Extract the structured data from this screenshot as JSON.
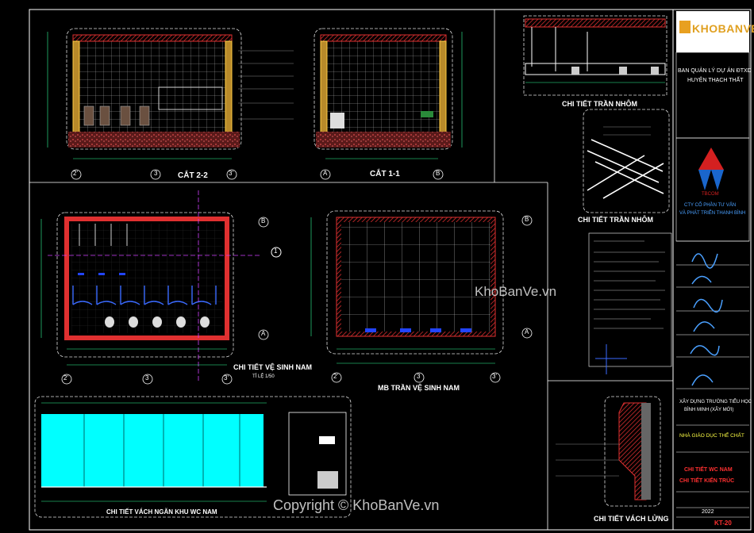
{
  "sheet": {
    "logo_text": "KHOBANVE",
    "owner_line1": "BAN QUẢN LÝ DỰ ÁN ĐTXD",
    "owner_line2": "HUYỆN THẠCH THẤT",
    "company_line1": "CTY CỔ PHẦN TƯ VẤN",
    "company_line2": "VÀ PHÁT TRIỂN THANH BÌNH",
    "company_abbr": "TBCOM",
    "project_line1": "XÂY DỰNG TRƯỜNG TIỂU HỌC",
    "project_line2": "BÌNH MINH (XÂY MỚI)",
    "building": "NHÀ GIÁO DỤC THỂ CHẤT",
    "drawing_title1": "CHI TIẾT WC NAM",
    "drawing_title2": "CHI TIẾT KIẾN TRÚC",
    "year": "2022",
    "sheet_no": "KT-20"
  },
  "views": {
    "section_22": "CẮT 2-2",
    "section_11": "CẮT 1-1",
    "ceiling_detail_a": "CHI TIẾT TRẦN NHÔM",
    "ceiling_detail_b": "CHI TIẾT TRẦN NHÔM",
    "wc_plan": "CHI TIẾT VỆ SINH NAM",
    "wc_plan_scale": "TỈ LỆ 1/50",
    "ceiling_plan": "MB TRẦN VỆ SINH NAM",
    "partition": "CHI TIẾT VÁCH NGĂN KHU WC NAM",
    "half_wall": "CHI TIẾT VÁCH LỬNG"
  },
  "axes": {
    "a": "A",
    "b": "B",
    "n1": "1",
    "n2": "2",
    "n3": "3",
    "n2p": "2'",
    "n3p": "3'"
  },
  "watermark": {
    "center": "KhoBanVe.vn",
    "bottom": "Copyright © KhoBanVe.vn"
  },
  "colors": {
    "frame": "#ffffff",
    "wall_hatch": "#e03030",
    "dim": "#33ff99",
    "partition_fill": "#00ffff",
    "brand_red": "#d42020",
    "brand_blue": "#1a66cc"
  }
}
